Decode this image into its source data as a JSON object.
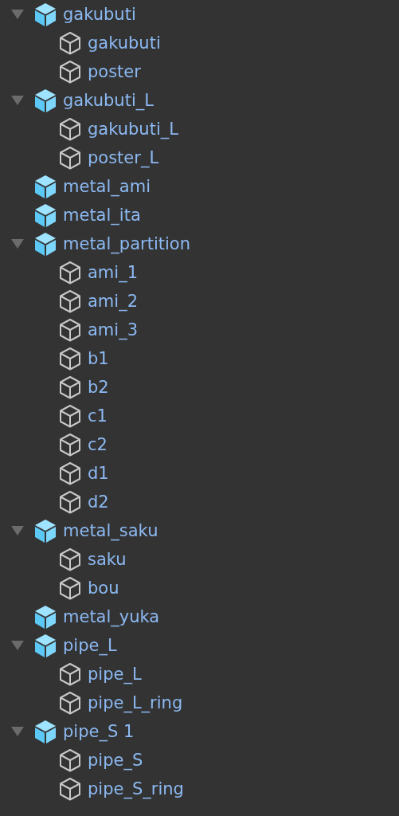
{
  "hierarchy": {
    "items": [
      {
        "name": "gakubuti",
        "expanded": true,
        "children": [
          {
            "name": "gakubuti"
          },
          {
            "name": "poster"
          }
        ]
      },
      {
        "name": "gakubuti_L",
        "expanded": true,
        "children": [
          {
            "name": "gakubuti_L"
          },
          {
            "name": "poster_L"
          }
        ]
      },
      {
        "name": "metal_ami"
      },
      {
        "name": "metal_ita"
      },
      {
        "name": "metal_partition",
        "expanded": true,
        "children": [
          {
            "name": "ami_1"
          },
          {
            "name": "ami_2"
          },
          {
            "name": "ami_3"
          },
          {
            "name": "b1"
          },
          {
            "name": "b2"
          },
          {
            "name": "c1"
          },
          {
            "name": "c2"
          },
          {
            "name": "d1"
          },
          {
            "name": "d2"
          }
        ]
      },
      {
        "name": "metal_saku",
        "expanded": true,
        "children": [
          {
            "name": "saku"
          },
          {
            "name": "bou"
          }
        ]
      },
      {
        "name": "metal_yuka"
      },
      {
        "name": "pipe_L",
        "expanded": true,
        "children": [
          {
            "name": "pipe_L"
          },
          {
            "name": "pipe_L_ring"
          }
        ]
      },
      {
        "name": "pipe_S 1",
        "expanded": true,
        "children": [
          {
            "name": "pipe_S"
          },
          {
            "name": "pipe_S_ring"
          }
        ]
      }
    ]
  }
}
